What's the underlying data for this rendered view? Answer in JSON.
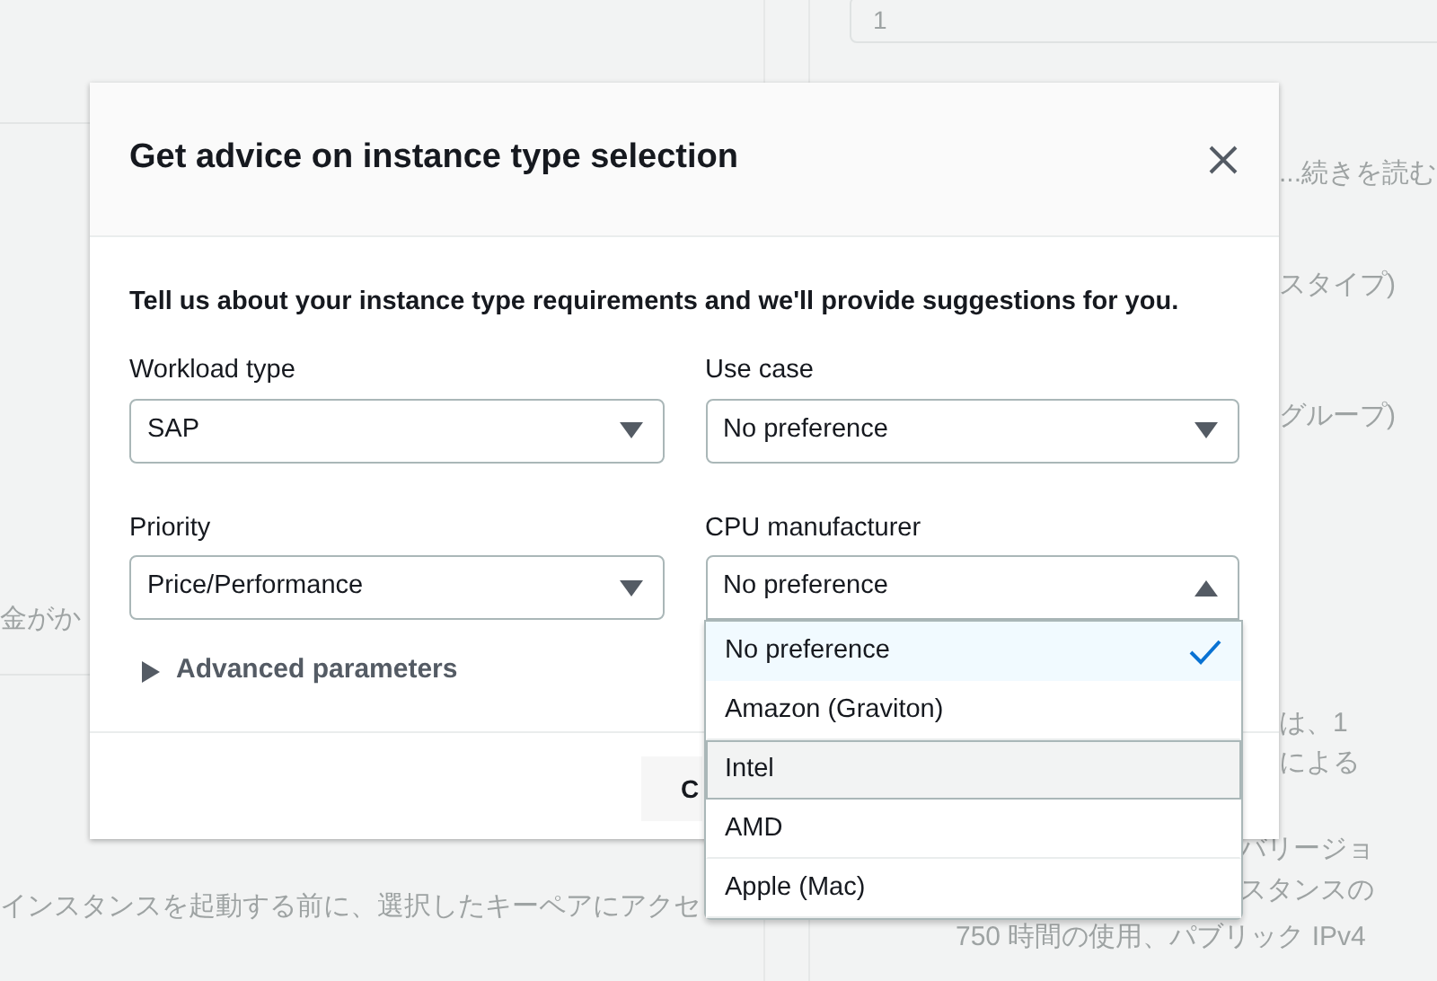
{
  "background": {
    "quantity_value": "1",
    "texts": [
      "...続きを読む",
      "スタイプ)",
      "グループ)",
      "金がか",
      "は、1",
      "による",
      "バリージョ",
      "スタンスの",
      "750 時間の使用、パブリック IPv4",
      "インスタンスを起動する前に、選択したキーペアにアクセ"
    ]
  },
  "dialog": {
    "title": "Get advice on instance type selection",
    "intro": "Tell us about your instance type requirements and we'll provide suggestions for you.",
    "fields": [
      {
        "label": "Workload type",
        "value": "SAP",
        "expanded": false
      },
      {
        "label": "Use case",
        "value": "No preference",
        "expanded": false
      },
      {
        "label": "Priority",
        "value": "Price/Performance",
        "expanded": false
      },
      {
        "label": "CPU manufacturer",
        "value": "No preference",
        "expanded": true
      }
    ],
    "advanced": {
      "label": "Advanced parameters",
      "expanded": false
    },
    "footer_button": "C"
  },
  "dropdown": {
    "options": [
      {
        "label": "No preference",
        "selected": true,
        "hovered": false
      },
      {
        "label": "Amazon (Graviton)",
        "selected": false,
        "hovered": false
      },
      {
        "label": "Intel",
        "selected": false,
        "hovered": true
      },
      {
        "label": "AMD",
        "selected": false,
        "hovered": false
      },
      {
        "label": "Apple (Mac)",
        "selected": false,
        "hovered": false
      }
    ]
  }
}
